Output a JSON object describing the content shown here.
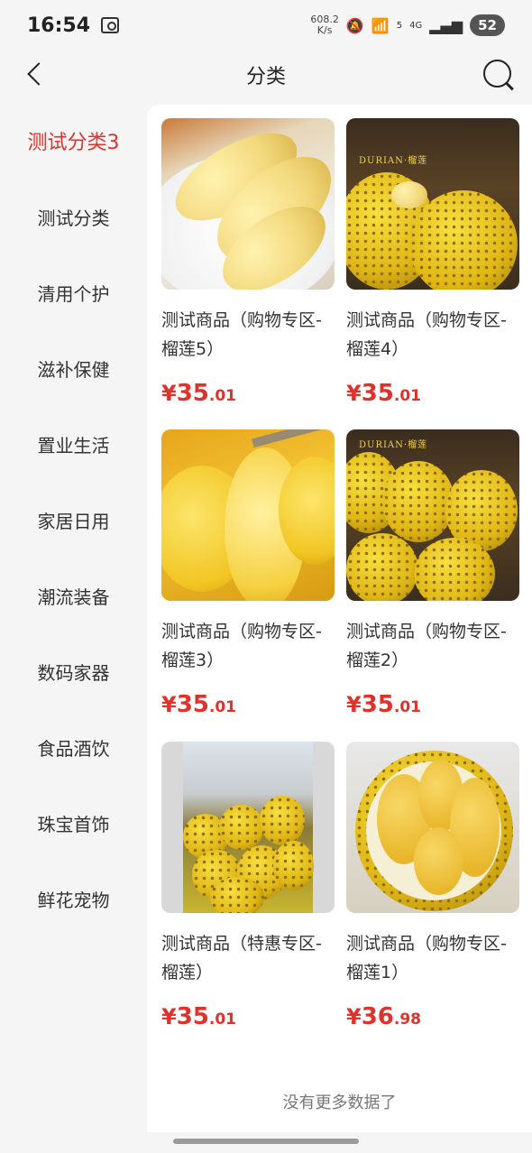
{
  "status_bar": {
    "time": "16:54",
    "net_speed_value": "608.2",
    "net_speed_unit": "K/s",
    "network": "4G",
    "wifi_level": "5",
    "battery": "52"
  },
  "nav": {
    "title": "分类"
  },
  "sidebar": {
    "items": [
      {
        "label": "测试分类3",
        "active": true
      },
      {
        "label": "测试分类",
        "active": false
      },
      {
        "label": "清用个护",
        "active": false
      },
      {
        "label": "滋补保健",
        "active": false
      },
      {
        "label": "置业生活",
        "active": false
      },
      {
        "label": "家居日用",
        "active": false
      },
      {
        "label": "潮流装备",
        "active": false
      },
      {
        "label": "数码家器",
        "active": false
      },
      {
        "label": "食品酒饮",
        "active": false
      },
      {
        "label": "珠宝首饰",
        "active": false
      },
      {
        "label": "鲜花宠物",
        "active": false
      }
    ]
  },
  "products": [
    {
      "name": "测试商品（购物专区-榴莲5）",
      "price_symbol": "¥",
      "price_int": "35",
      "price_dec": ".01",
      "image": "durian-pulp-on-plate"
    },
    {
      "name": "测试商品（购物专区-榴莲4）",
      "price_symbol": "¥",
      "price_int": "35",
      "price_dec": ".01",
      "image": "durian-boxed-whole",
      "image_text": "DURIAN·榴莲"
    },
    {
      "name": "测试商品（购物专区-榴莲3）",
      "price_symbol": "¥",
      "price_int": "35",
      "price_dec": ".01",
      "image": "durian-pulp-fork"
    },
    {
      "name": "测试商品（购物专区-榴莲2）",
      "price_symbol": "¥",
      "price_int": "35",
      "price_dec": ".01",
      "image": "durian-boxed-pile",
      "image_text": "DURIAN·榴莲"
    },
    {
      "name": "测试商品（特惠专区-榴莲）",
      "price_symbol": "¥",
      "price_int": "35",
      "price_dec": ".01",
      "image": "durian-market-pile"
    },
    {
      "name": "测试商品（购物专区-榴莲1）",
      "price_symbol": "¥",
      "price_int": "36",
      "price_dec": ".98",
      "image": "durian-opened"
    }
  ],
  "footer": {
    "no_more_text": "没有更多数据了"
  },
  "colors": {
    "accent": "#e0322b",
    "background": "#f5f5f5",
    "content_bg": "#ffffff"
  }
}
